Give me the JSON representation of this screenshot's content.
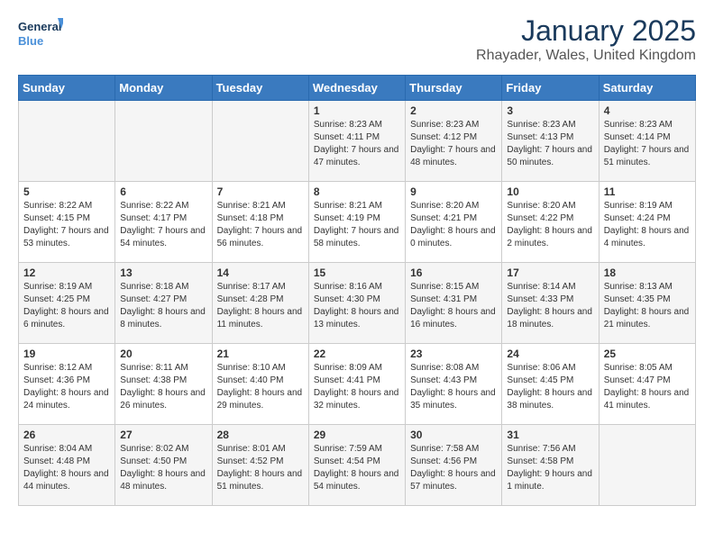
{
  "header": {
    "logo_line1": "General",
    "logo_line2": "Blue",
    "month": "January 2025",
    "location": "Rhayader, Wales, United Kingdom"
  },
  "days_of_week": [
    "Sunday",
    "Monday",
    "Tuesday",
    "Wednesday",
    "Thursday",
    "Friday",
    "Saturday"
  ],
  "weeks": [
    [
      {
        "day": "",
        "info": ""
      },
      {
        "day": "",
        "info": ""
      },
      {
        "day": "",
        "info": ""
      },
      {
        "day": "1",
        "info": "Sunrise: 8:23 AM\nSunset: 4:11 PM\nDaylight: 7 hours and 47 minutes."
      },
      {
        "day": "2",
        "info": "Sunrise: 8:23 AM\nSunset: 4:12 PM\nDaylight: 7 hours and 48 minutes."
      },
      {
        "day": "3",
        "info": "Sunrise: 8:23 AM\nSunset: 4:13 PM\nDaylight: 7 hours and 50 minutes."
      },
      {
        "day": "4",
        "info": "Sunrise: 8:23 AM\nSunset: 4:14 PM\nDaylight: 7 hours and 51 minutes."
      }
    ],
    [
      {
        "day": "5",
        "info": "Sunrise: 8:22 AM\nSunset: 4:15 PM\nDaylight: 7 hours and 53 minutes."
      },
      {
        "day": "6",
        "info": "Sunrise: 8:22 AM\nSunset: 4:17 PM\nDaylight: 7 hours and 54 minutes."
      },
      {
        "day": "7",
        "info": "Sunrise: 8:21 AM\nSunset: 4:18 PM\nDaylight: 7 hours and 56 minutes."
      },
      {
        "day": "8",
        "info": "Sunrise: 8:21 AM\nSunset: 4:19 PM\nDaylight: 7 hours and 58 minutes."
      },
      {
        "day": "9",
        "info": "Sunrise: 8:20 AM\nSunset: 4:21 PM\nDaylight: 8 hours and 0 minutes."
      },
      {
        "day": "10",
        "info": "Sunrise: 8:20 AM\nSunset: 4:22 PM\nDaylight: 8 hours and 2 minutes."
      },
      {
        "day": "11",
        "info": "Sunrise: 8:19 AM\nSunset: 4:24 PM\nDaylight: 8 hours and 4 minutes."
      }
    ],
    [
      {
        "day": "12",
        "info": "Sunrise: 8:19 AM\nSunset: 4:25 PM\nDaylight: 8 hours and 6 minutes."
      },
      {
        "day": "13",
        "info": "Sunrise: 8:18 AM\nSunset: 4:27 PM\nDaylight: 8 hours and 8 minutes."
      },
      {
        "day": "14",
        "info": "Sunrise: 8:17 AM\nSunset: 4:28 PM\nDaylight: 8 hours and 11 minutes."
      },
      {
        "day": "15",
        "info": "Sunrise: 8:16 AM\nSunset: 4:30 PM\nDaylight: 8 hours and 13 minutes."
      },
      {
        "day": "16",
        "info": "Sunrise: 8:15 AM\nSunset: 4:31 PM\nDaylight: 8 hours and 16 minutes."
      },
      {
        "day": "17",
        "info": "Sunrise: 8:14 AM\nSunset: 4:33 PM\nDaylight: 8 hours and 18 minutes."
      },
      {
        "day": "18",
        "info": "Sunrise: 8:13 AM\nSunset: 4:35 PM\nDaylight: 8 hours and 21 minutes."
      }
    ],
    [
      {
        "day": "19",
        "info": "Sunrise: 8:12 AM\nSunset: 4:36 PM\nDaylight: 8 hours and 24 minutes."
      },
      {
        "day": "20",
        "info": "Sunrise: 8:11 AM\nSunset: 4:38 PM\nDaylight: 8 hours and 26 minutes."
      },
      {
        "day": "21",
        "info": "Sunrise: 8:10 AM\nSunset: 4:40 PM\nDaylight: 8 hours and 29 minutes."
      },
      {
        "day": "22",
        "info": "Sunrise: 8:09 AM\nSunset: 4:41 PM\nDaylight: 8 hours and 32 minutes."
      },
      {
        "day": "23",
        "info": "Sunrise: 8:08 AM\nSunset: 4:43 PM\nDaylight: 8 hours and 35 minutes."
      },
      {
        "day": "24",
        "info": "Sunrise: 8:06 AM\nSunset: 4:45 PM\nDaylight: 8 hours and 38 minutes."
      },
      {
        "day": "25",
        "info": "Sunrise: 8:05 AM\nSunset: 4:47 PM\nDaylight: 8 hours and 41 minutes."
      }
    ],
    [
      {
        "day": "26",
        "info": "Sunrise: 8:04 AM\nSunset: 4:48 PM\nDaylight: 8 hours and 44 minutes."
      },
      {
        "day": "27",
        "info": "Sunrise: 8:02 AM\nSunset: 4:50 PM\nDaylight: 8 hours and 48 minutes."
      },
      {
        "day": "28",
        "info": "Sunrise: 8:01 AM\nSunset: 4:52 PM\nDaylight: 8 hours and 51 minutes."
      },
      {
        "day": "29",
        "info": "Sunrise: 7:59 AM\nSunset: 4:54 PM\nDaylight: 8 hours and 54 minutes."
      },
      {
        "day": "30",
        "info": "Sunrise: 7:58 AM\nSunset: 4:56 PM\nDaylight: 8 hours and 57 minutes."
      },
      {
        "day": "31",
        "info": "Sunrise: 7:56 AM\nSunset: 4:58 PM\nDaylight: 9 hours and 1 minute."
      },
      {
        "day": "",
        "info": ""
      }
    ]
  ]
}
